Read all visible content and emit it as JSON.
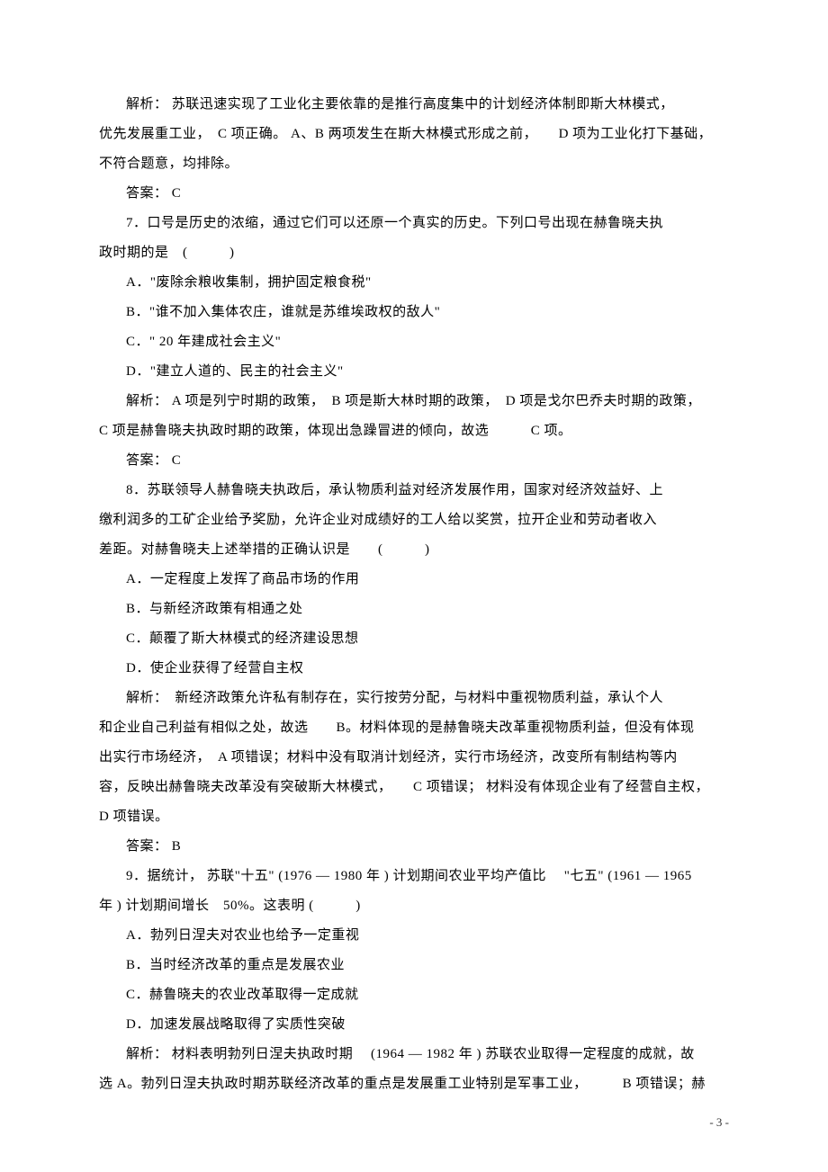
{
  "q6": {
    "analysis": "解析： 苏联迅速实现了工业化主要依靠的是推行高度集中的计划经济体制即斯大林模式，",
    "analysis2": "优先发展重工业，　C 项正确。 A、B 两项发生在斯大林模式形成之前，　　D 项为工业化打下基础，",
    "analysis3": "不符合题意，均排除。",
    "answer": "答案： C"
  },
  "q7": {
    "stem": "7．口号是历史的浓缩，通过它们可以还原一个真实的历史。下列口号出现在赫鲁晓夫执",
    "stem2": "政时期的是　(　　　)",
    "a": "A．\"废除余粮收集制，拥护固定粮食税\"",
    "b": "B．\"谁不加入集体农庄，谁就是苏维埃政权的敌人\"",
    "c": "C．\" 20 年建成社会主义\"",
    "d": "D．\"建立人道的、民主的社会主义\"",
    "analysis": "解析： A 项是列宁时期的政策，　B 项是斯大林时期的政策，　D 项是戈尔巴乔夫时期的政策，",
    "analysis2": "C 项是赫鲁晓夫执政时期的政策，体现出急躁冒进的倾向，故选　　　C 项。",
    "answer": "答案： C"
  },
  "q8": {
    "stem": "8．苏联领导人赫鲁晓夫执政后，承认物质利益对经济发展作用，国家对经济效益好、上",
    "stem2": "缴利润多的工矿企业给予奖励，允许企业对成绩好的工人给以奖赏，拉开企业和劳动者收入",
    "stem3": "差距。对赫鲁晓夫上述举措的正确认识是　　(　　　)",
    "a": "A．一定程度上发挥了商品市场的作用",
    "b": "B．与新经济政策有相通之处",
    "c": "C．颠覆了斯大林模式的经济建设思想",
    "d": "D．使企业获得了经营自主权",
    "analysis": "解析：　新经济政策允许私有制存在，实行按劳分配，与材料中重视物质利益，承认个人",
    "analysis2": "和企业自己利益有相似之处，故选　　B。材料体现的是赫鲁晓夫改革重视物质利益，但没有体现",
    "analysis3": "出实行市场经济，　A 项错误；材料中没有取消计划经济，实行市场经济，改变所有制结构等内",
    "analysis4": "容，反映出赫鲁晓夫改革没有突破斯大林模式，　　C 项错误；  材料没有体现企业有了经营自主权，",
    "analysis5": "D 项错误。",
    "answer": "答案： B"
  },
  "q9": {
    "stem": "9．据统计， 苏联\"十五\"  (1976 — 1980 年 ) 计划期间农业平均产值比　 \"七五\"  (1961 — 1965",
    "stem2": "年 ) 计划期间增长　50%。这表明 (　　　)",
    "a": "A．勃列日涅夫对农业也给予一定重视",
    "b": "B．当时经济改革的重点是发展农业",
    "c": "C．赫鲁晓夫的农业改革取得一定成就",
    "d": "D．加速发展战略取得了实质性突破",
    "analysis": "解析：  材料表明勃列日涅夫执政时期　 (1964 — 1982 年 ) 苏联农业取得一定程度的成就，故",
    "analysis2": "选 A。勃列日涅夫执政时期苏联经济改革的重点是发展重工业特别是军事工业，　　　B 项错误；赫"
  },
  "pagenum": "- 3 -"
}
